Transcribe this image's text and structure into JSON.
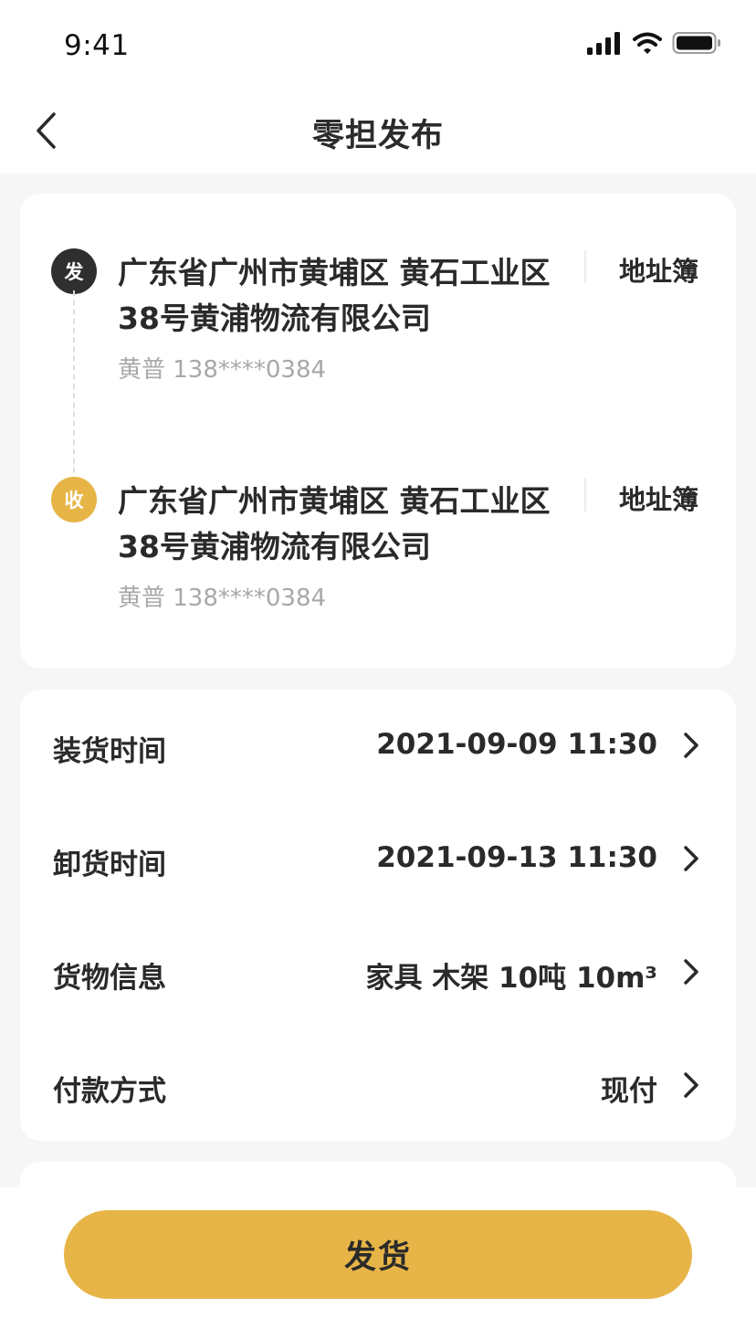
{
  "status_bar": {
    "time": "9:41",
    "icons": [
      "signal-icon",
      "wifi-icon",
      "battery-icon"
    ]
  },
  "nav": {
    "title": "零担发布",
    "back_icon": "chevron-left-icon"
  },
  "sender": {
    "badge": "发",
    "address": "广东省广州市黄埔区 黄石工业区38号黄浦物流有限公司",
    "contact": "黄普 138****0384",
    "address_book_label": "地址簿"
  },
  "receiver": {
    "badge": "收",
    "address": "广东省广州市黄埔区 黄石工业区38号黄浦物流有限公司",
    "contact": "黄普 138****0384",
    "address_book_label": "地址簿"
  },
  "info_rows": [
    {
      "label": "装货时间",
      "value": "2021-09-09 11:30"
    },
    {
      "label": "卸货时间",
      "value": "2021-09-13 11:30"
    },
    {
      "label": "货物信息",
      "value": "家具 木架 10吨 10m³"
    },
    {
      "label": "付款方式",
      "value": "现付"
    }
  ],
  "submit_button": {
    "label": "发货"
  },
  "colors": {
    "accent": "#e7b547",
    "send_badge": "#2f2f2f",
    "text_primary": "#2a2a2a",
    "text_secondary": "#a8a8a8",
    "page_background": "#f6f6f6"
  }
}
